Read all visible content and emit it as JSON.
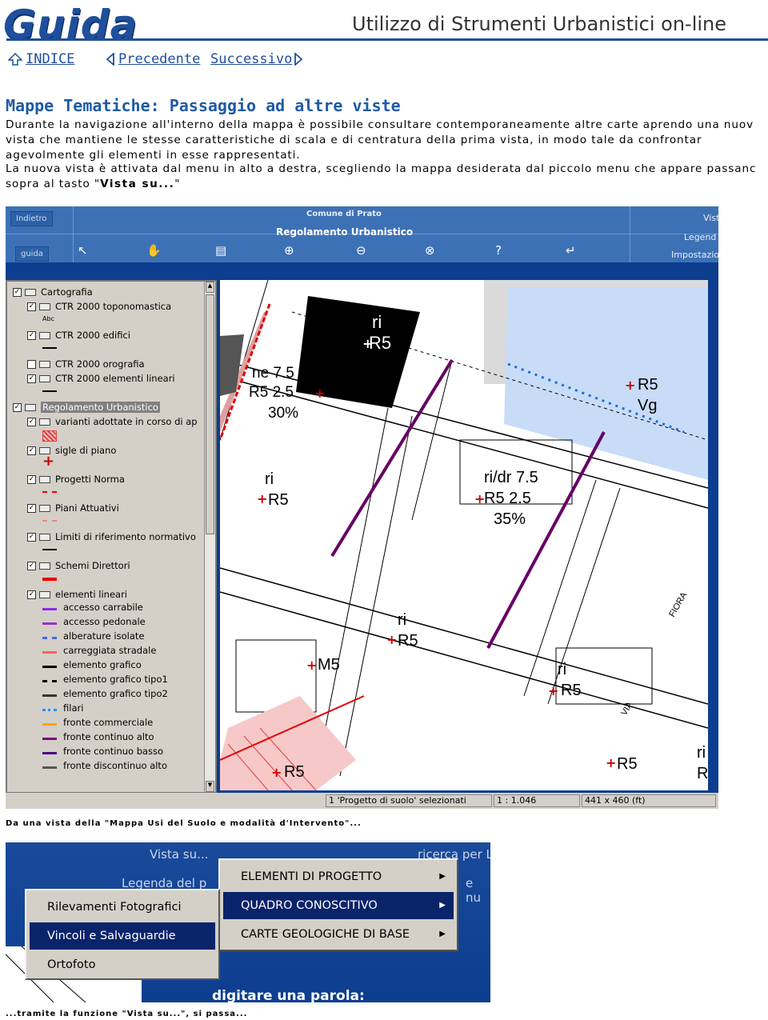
{
  "header": {
    "logo": "Guida",
    "subtitle": "Utilizzo di Strumenti Urbanistici on-line"
  },
  "nav": {
    "index": "INDICE",
    "previous": "Precedente",
    "next": "Successivo"
  },
  "section": {
    "title": "Mappe Tematiche: Passaggio ad altre viste",
    "para1": [
      "Durante la navigazione all'interno della mappa è possibile consultare contemporaneamente altre carte aprendo una nuov",
      "vista che mantiene le stesse caratteristiche di scala e di centratura della prima vista, in modo tale da confrontar",
      "agevolmente gli elementi in esse rappresentati."
    ],
    "para2": [
      "La nuova vista è attivata dal menu in alto a destra, scegliendo la mappa desiderata dal piccolo menu che appare passanc"
    ],
    "para2_last_prefix": "sopra al tasto \"",
    "para2_last_bold": "Vista su...",
    "para2_last_suffix": "\"",
    "caption1": "Da una vista della \"Mappa Usi del Suolo e modalità d'Intervento\"...",
    "caption2": "...tramite la funzione \"Vista su...\", si passa..."
  },
  "screenshot1": {
    "toolbar": {
      "back_button": "Indietro",
      "guide_button": "guida",
      "municipality": "Comune di Prato",
      "map_title": "Regolamento Urbanistico",
      "right_vista": "Vist",
      "right_legend": "Legend",
      "right_settings": "Impostazio",
      "tools": [
        "↖",
        "✋",
        "▤",
        "⊕",
        "⊖",
        "⊗",
        "?",
        "↵"
      ]
    },
    "legend": {
      "groups": [
        {
          "label": "Cartografia",
          "checked": true,
          "indent": 0
        },
        {
          "label": "CTR 2000 toponomastica",
          "checked": true,
          "indent": 1,
          "note": "Abc"
        },
        {
          "label": "CTR 2000 edifici",
          "checked": true,
          "indent": 1
        },
        {
          "label": "CTR 2000 orografia",
          "checked": false,
          "indent": 1
        },
        {
          "label": "CTR 2000 elementi lineari",
          "checked": true,
          "indent": 1
        },
        {
          "label": "Regolamento Urbanistico",
          "checked": true,
          "indent": 0,
          "selected": true
        },
        {
          "label": "varianti adottate in corso di ap",
          "checked": true,
          "indent": 1
        },
        {
          "label": "sigle di piano",
          "checked": true,
          "indent": 1
        },
        {
          "label": "Progetti Norma",
          "checked": true,
          "indent": 1
        },
        {
          "label": "Piani Attuativi",
          "checked": true,
          "indent": 1
        },
        {
          "label": "Limiti di riferimento normativo",
          "checked": true,
          "indent": 1
        },
        {
          "label": "Schemi Direttori",
          "checked": true,
          "indent": 1
        },
        {
          "label": "elementi lineari",
          "checked": true,
          "indent": 1
        }
      ],
      "line_items": [
        {
          "label": "accesso carrabile",
          "color": "#8a2be2",
          "style": "solid"
        },
        {
          "label": "accesso pedonale",
          "color": "#9932cc",
          "style": "solid"
        },
        {
          "label": "alberature isolate",
          "color": "#4169e1",
          "style": "dashed"
        },
        {
          "label": "carreggiata stradale",
          "color": "#ff6060",
          "style": "solid"
        },
        {
          "label": "elemento grafico",
          "color": "#000000",
          "style": "solid"
        },
        {
          "label": "elemento grafico tipo1",
          "color": "#000000",
          "style": "dashed"
        },
        {
          "label": "elemento grafico tipo2",
          "color": "#333333",
          "style": "solid"
        },
        {
          "label": "filari",
          "color": "#1e90ff",
          "style": "dotted"
        },
        {
          "label": "fronte commerciale",
          "color": "#ffa500",
          "style": "solid"
        },
        {
          "label": "fronte continuo alto",
          "color": "#800080",
          "style": "solid"
        },
        {
          "label": "fronte continuo basso",
          "color": "#4b0082",
          "style": "solid"
        },
        {
          "label": "fronte discontinuo alto",
          "color": "#555555",
          "style": "solid"
        }
      ]
    },
    "map_labels": {
      "l1": "ri",
      "l2": "R5",
      "l3": "ne 7.5",
      "l4": "R5 2.5",
      "l5": "30%",
      "l6": "R5",
      "l7": "Vg",
      "l8": "ri",
      "l9": "R5",
      "l10": "ri/dr 7.5",
      "l11": "R5 2.5",
      "l12": "35%",
      "l13": "ri",
      "l14": "R5",
      "l15": "M5",
      "l16": "ri",
      "l17": "R5",
      "l18": "R5",
      "l19": "ri",
      "l20": "R",
      "l21": "R5",
      "street1": "FIORA",
      "street2": "VIA"
    },
    "status": {
      "selected": "1 'Progetto di suolo' selezionati",
      "scale": "1 : 1.046",
      "size": "441 x 460 (ft)"
    }
  },
  "screenshot2": {
    "bg_vista": "Vista su...",
    "bg_legend": "Legenda del p",
    "bg_search": "ricerca per Lo",
    "bg_nu": "e nu",
    "bg_prompt": "digitare una parola:",
    "submenu": [
      {
        "label": "ELEMENTI DI PROGETTO",
        "selected": false
      },
      {
        "label": "QUADRO CONOSCITIVO",
        "selected": true
      },
      {
        "label": "CARTE GEOLOGICHE DI BASE",
        "selected": false
      }
    ],
    "submenu2": [
      {
        "label": "Rilevamenti Fotografici",
        "selected": false
      },
      {
        "label": "Vincoli e Salvaguardie",
        "selected": true
      },
      {
        "label": "Ortofoto",
        "selected": false
      }
    ]
  }
}
